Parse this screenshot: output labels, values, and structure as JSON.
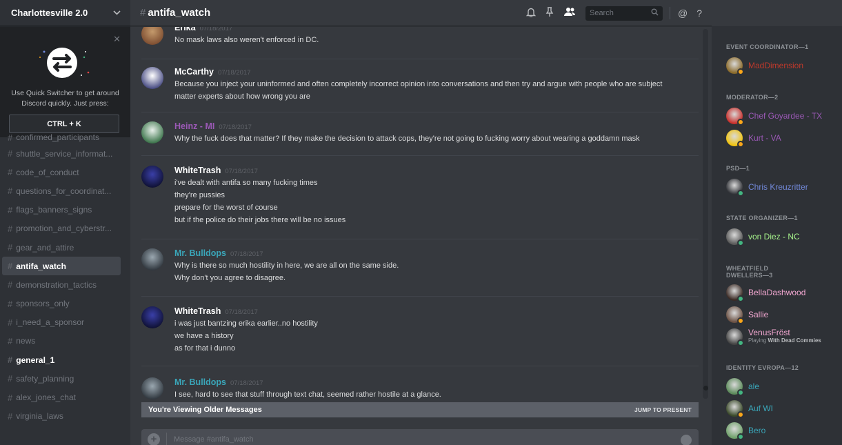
{
  "guild": {
    "name": "Charlottesville 2.0"
  },
  "quick_switcher": {
    "text": "Use Quick Switcher to get around Discord quickly. Just press:",
    "shortcut": "CTRL + K"
  },
  "channels": [
    {
      "name": "confirmed_participants",
      "state": "cut"
    },
    {
      "name": "shuttle_service_informat...",
      "state": "normal"
    },
    {
      "name": "code_of_conduct",
      "state": "normal"
    },
    {
      "name": "questions_for_coordinat...",
      "state": "normal"
    },
    {
      "name": "flags_banners_signs",
      "state": "normal"
    },
    {
      "name": "promotion_and_cyberstr...",
      "state": "normal"
    },
    {
      "name": "gear_and_attire",
      "state": "normal"
    },
    {
      "name": "antifa_watch",
      "state": "active"
    },
    {
      "name": "demonstration_tactics",
      "state": "normal"
    },
    {
      "name": "sponsors_only",
      "state": "normal"
    },
    {
      "name": "i_need_a_sponsor",
      "state": "normal"
    },
    {
      "name": "news",
      "state": "normal"
    },
    {
      "name": "general_1",
      "state": "unread"
    },
    {
      "name": "safety_planning",
      "state": "normal"
    },
    {
      "name": "alex_jones_chat",
      "state": "normal"
    },
    {
      "name": "virginia_laws",
      "state": "normal"
    }
  ],
  "header": {
    "channel": "antifa_watch",
    "search_placeholder": "Search"
  },
  "messages": [
    {
      "author": "Erika",
      "color": "#ffffff",
      "timestamp": "07/18/2017",
      "lines": [
        "No mask laws also weren't enforced in DC."
      ]
    },
    {
      "author": "McCarthy",
      "color": "#ffffff",
      "timestamp": "07/18/2017",
      "lines": [
        "Because you inject your uninformed and often completely incorrect opinion into conversations and then try and argue with people who are subject",
        "matter experts about how wrong you are"
      ]
    },
    {
      "author": "Heinz - MI",
      "color": "#9b59b6",
      "timestamp": "07/18/2017",
      "lines": [
        "Why the fuck does that matter? If they make the decision to attack cops, they're not going to fucking worry about wearing a goddamn mask"
      ]
    },
    {
      "author": "WhiteTrash",
      "color": "#ffffff",
      "timestamp": "07/18/2017",
      "lines": [
        "i've dealt with antifa so many fucking times",
        "they're pussies",
        "prepare for the worst of course",
        "but if the police do their jobs there will be no issues"
      ]
    },
    {
      "author": "Mr. Bulldops",
      "color": "#3aa6b9",
      "timestamp": "07/18/2017",
      "lines": [
        "Why is there so much hostility in here, we are all on the same side.",
        "Why don't you agree to disagree."
      ]
    },
    {
      "author": "WhiteTrash",
      "color": "#ffffff",
      "timestamp": "07/18/2017",
      "lines": [
        "i was just bantzing erika earlier..no hostility",
        "we have a history",
        "as for that i dunno"
      ]
    },
    {
      "author": "Mr. Bulldops",
      "color": "#3aa6b9",
      "timestamp": "07/18/2017",
      "lines": [
        "I see, hard to see that stuff through text chat, seemed rather hostile at a glance."
      ]
    }
  ],
  "older_bar": {
    "text": "You're Viewing Older Messages",
    "jump": "JUMP TO PRESENT"
  },
  "composer": {
    "placeholder": "Message #antifa_watch"
  },
  "member_groups": [
    {
      "role": "EVENT COORDINATOR—1",
      "members": [
        {
          "name": "MadDimension",
          "color": "#c0392b",
          "status": "#faa61a"
        }
      ]
    },
    {
      "role": "MODERATOR—2",
      "members": [
        {
          "name": "Chef Goyardee - TX",
          "color": "#9b59b6",
          "status": "#faa61a"
        },
        {
          "name": "Kurt - VA",
          "color": "#9b59b6",
          "status": "#faa61a"
        }
      ]
    },
    {
      "role": "PSD—1",
      "members": [
        {
          "name": "Chris Kreuzritter",
          "color": "#7289da",
          "status": "#43b581"
        }
      ]
    },
    {
      "role": "STATE ORGANIZER—1",
      "members": [
        {
          "name": "von Diez - NC",
          "color": "#a6f28b",
          "status": "#43b581"
        }
      ]
    },
    {
      "role": "WHEATFIELD DWELLERS—3",
      "members": [
        {
          "name": "BellaDashwood",
          "color": "#f5a9d3",
          "status": "#43b581"
        },
        {
          "name": "Sallie",
          "color": "#f5a9d3",
          "status": "#faa61a"
        },
        {
          "name": "VenusFröst",
          "color": "#f5a9d3",
          "status": "#43b581",
          "game_prefix": "Playing ",
          "game": "With Dead Commies"
        }
      ]
    },
    {
      "role": "IDENTITY EVROPA—12",
      "members": [
        {
          "name": "ale",
          "color": "#3aa6b9",
          "status": "#43b581"
        },
        {
          "name": "Auf WI",
          "color": "#3aa6b9",
          "status": "#faa61a"
        },
        {
          "name": "Bero",
          "color": "#3aa6b9",
          "status": "#43b581"
        }
      ]
    }
  ]
}
